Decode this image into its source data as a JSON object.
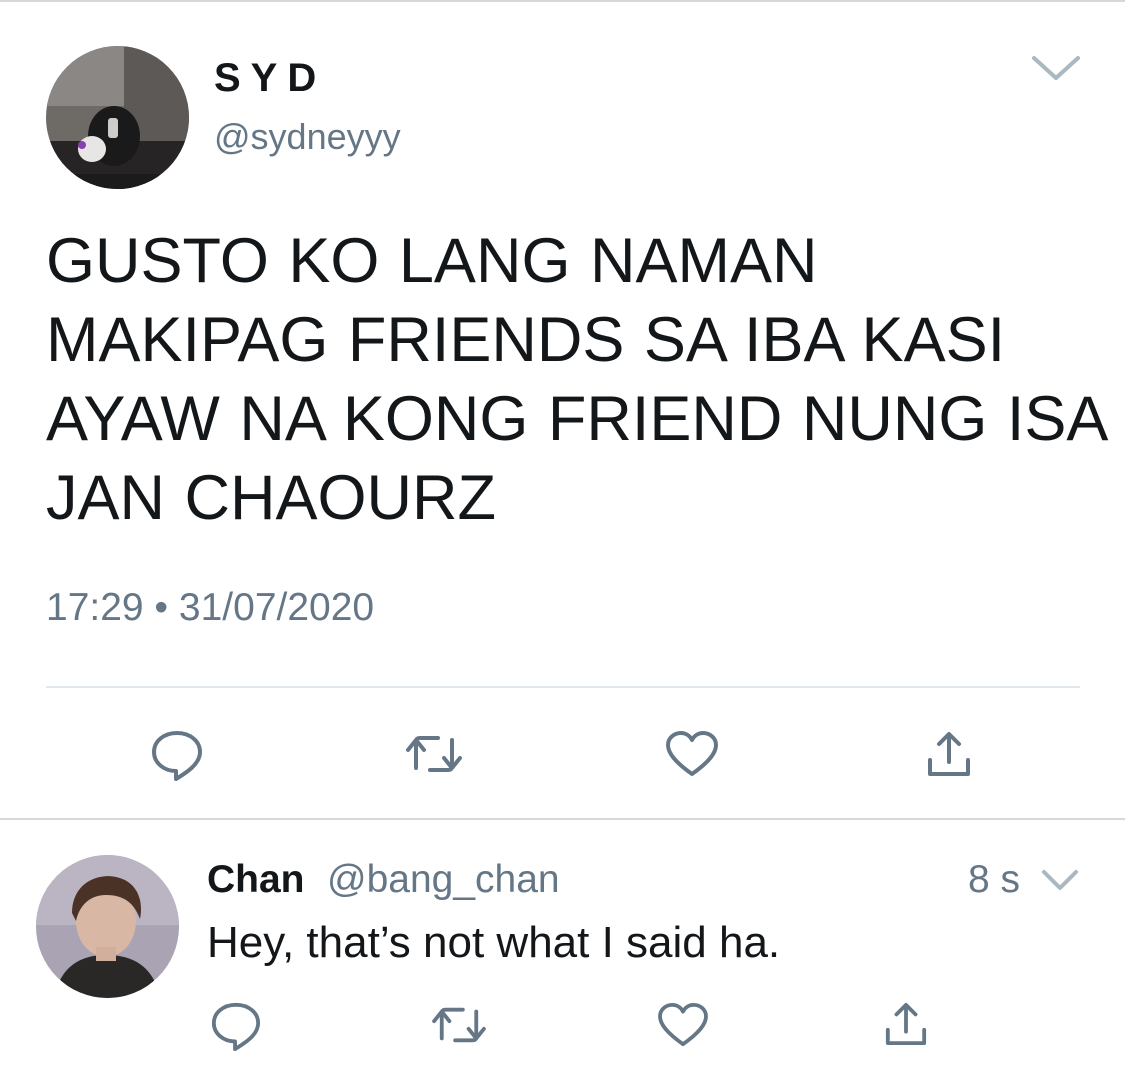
{
  "main_tweet": {
    "display_name": "SYD",
    "handle": "@sydneyyy",
    "text": "GUSTO KO LANG NAMAN MAKIPAG FRIENDS SA IBA KASI AYAW NA KONG FRIEND NUNG ISA JAN CHAOURZ",
    "timestamp": "17:29 • 31/07/2020",
    "avatar_icon": "user-avatar-photo",
    "menu_icon": "chevron-down-icon",
    "actions": [
      "reply-icon",
      "retweet-icon",
      "like-icon",
      "share-icon"
    ]
  },
  "reply_tweet": {
    "display_name": "Chan",
    "handle": "@bang_chan",
    "time_ago": "8 s",
    "text": "Hey, that’s not what I said ha.",
    "avatar_icon": "user-avatar-photo",
    "menu_icon": "chevron-down-icon",
    "actions": [
      "reply-icon",
      "retweet-icon",
      "like-icon",
      "share-icon"
    ]
  },
  "colors": {
    "text_primary": "#14171a",
    "text_secondary": "#657786",
    "icon": "#657786",
    "divider": "#e1e8ed",
    "background": "#ffffff"
  }
}
